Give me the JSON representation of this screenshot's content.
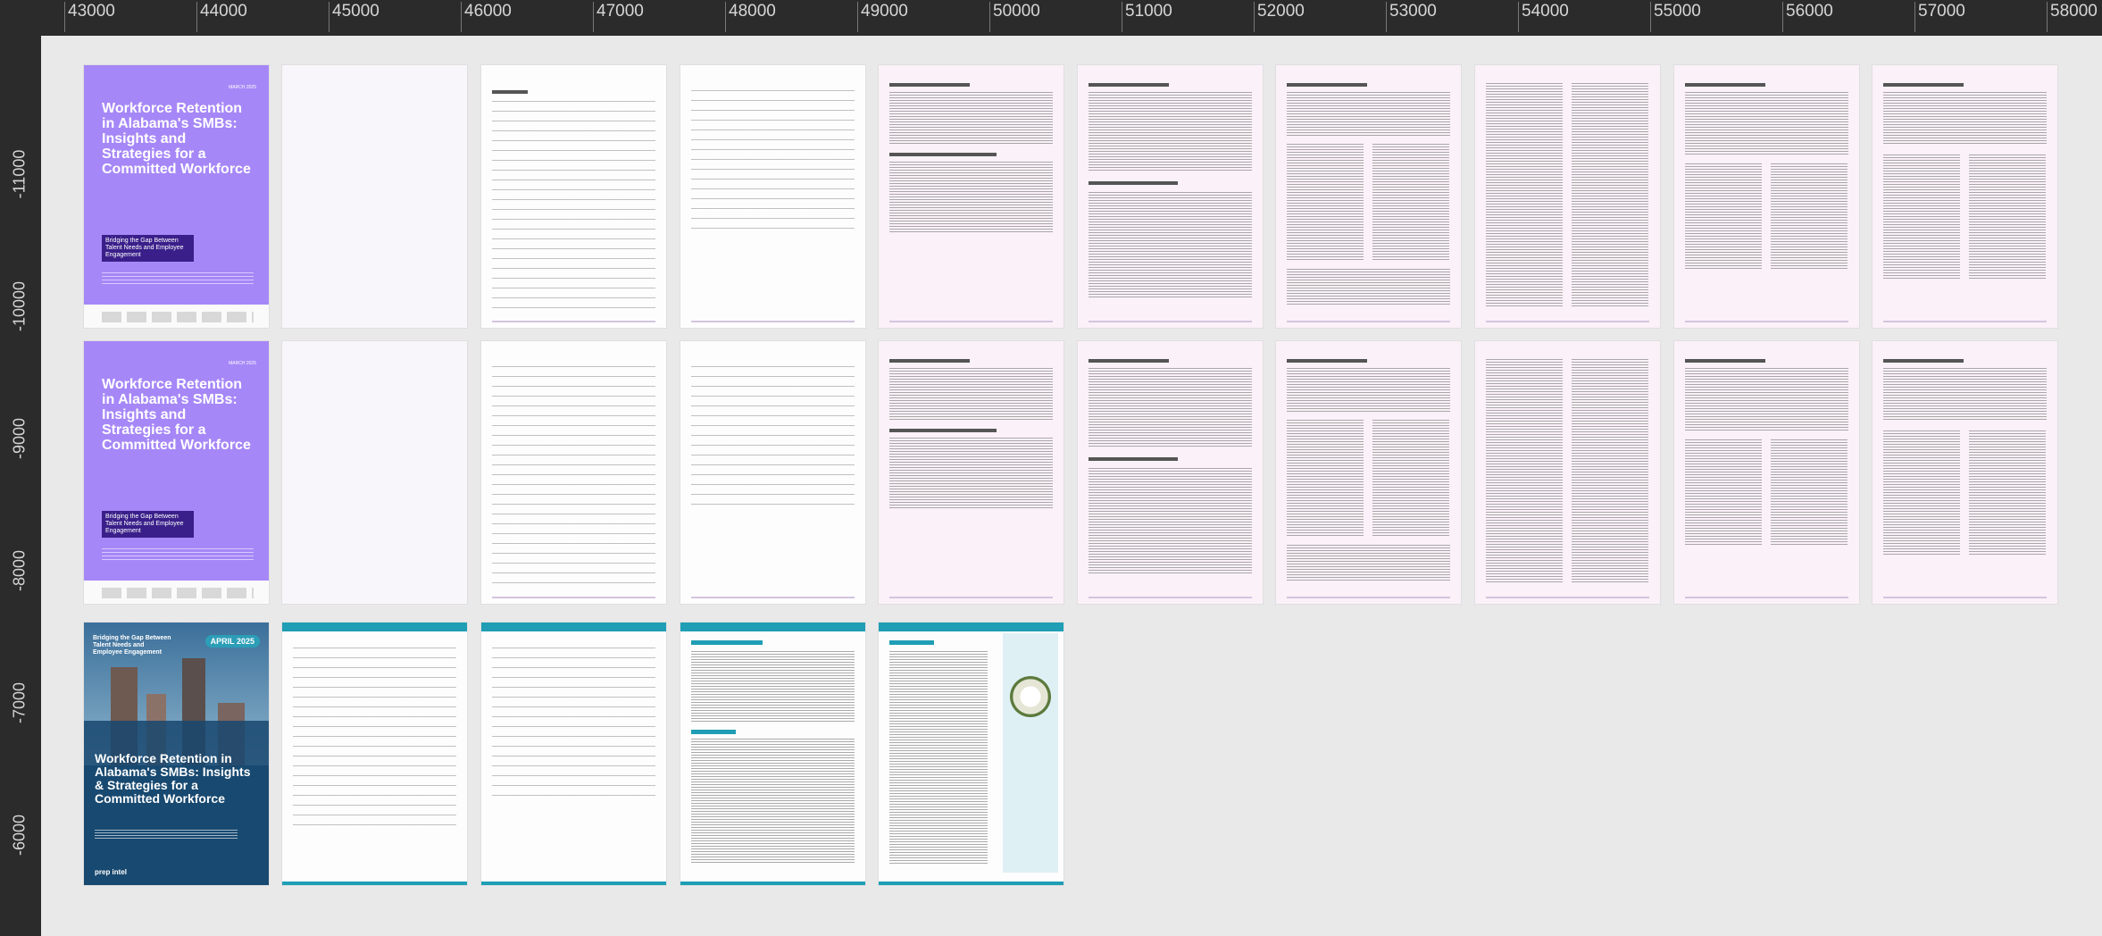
{
  "ruler": {
    "x_labels": [
      "43000",
      "44000",
      "45000",
      "46000",
      "47000",
      "48000",
      "49000",
      "50000",
      "51000",
      "52000",
      "53000",
      "54000",
      "55000",
      "56000",
      "57000",
      "58000"
    ],
    "y_labels": [
      "-11000",
      "-10000",
      "-9000",
      "-8000",
      "-7000",
      "-6000"
    ]
  },
  "purple_cover": {
    "date": "MARCH 2025",
    "title": "Workforce Retention in Alabama's SMBs: Insights and Strategies for a Committed Workforce",
    "tagline": "Bridging the Gap Between Talent Needs and Employee Engagement"
  },
  "teal_cover": {
    "badge": "Bridging the Gap Between Talent Needs and Employee Engagement",
    "date": "APRIL 2025",
    "title": "Workforce Retention in Alabama's SMBs: Insights & Strategies for a Committed Workforce",
    "logos": "prep intel"
  },
  "colors": {
    "ruler_bg": "#2b2b2b",
    "canvas_bg": "#e9e9e9",
    "purple_accent": "#a687f7",
    "teal_accent": "#1f9eb5"
  }
}
